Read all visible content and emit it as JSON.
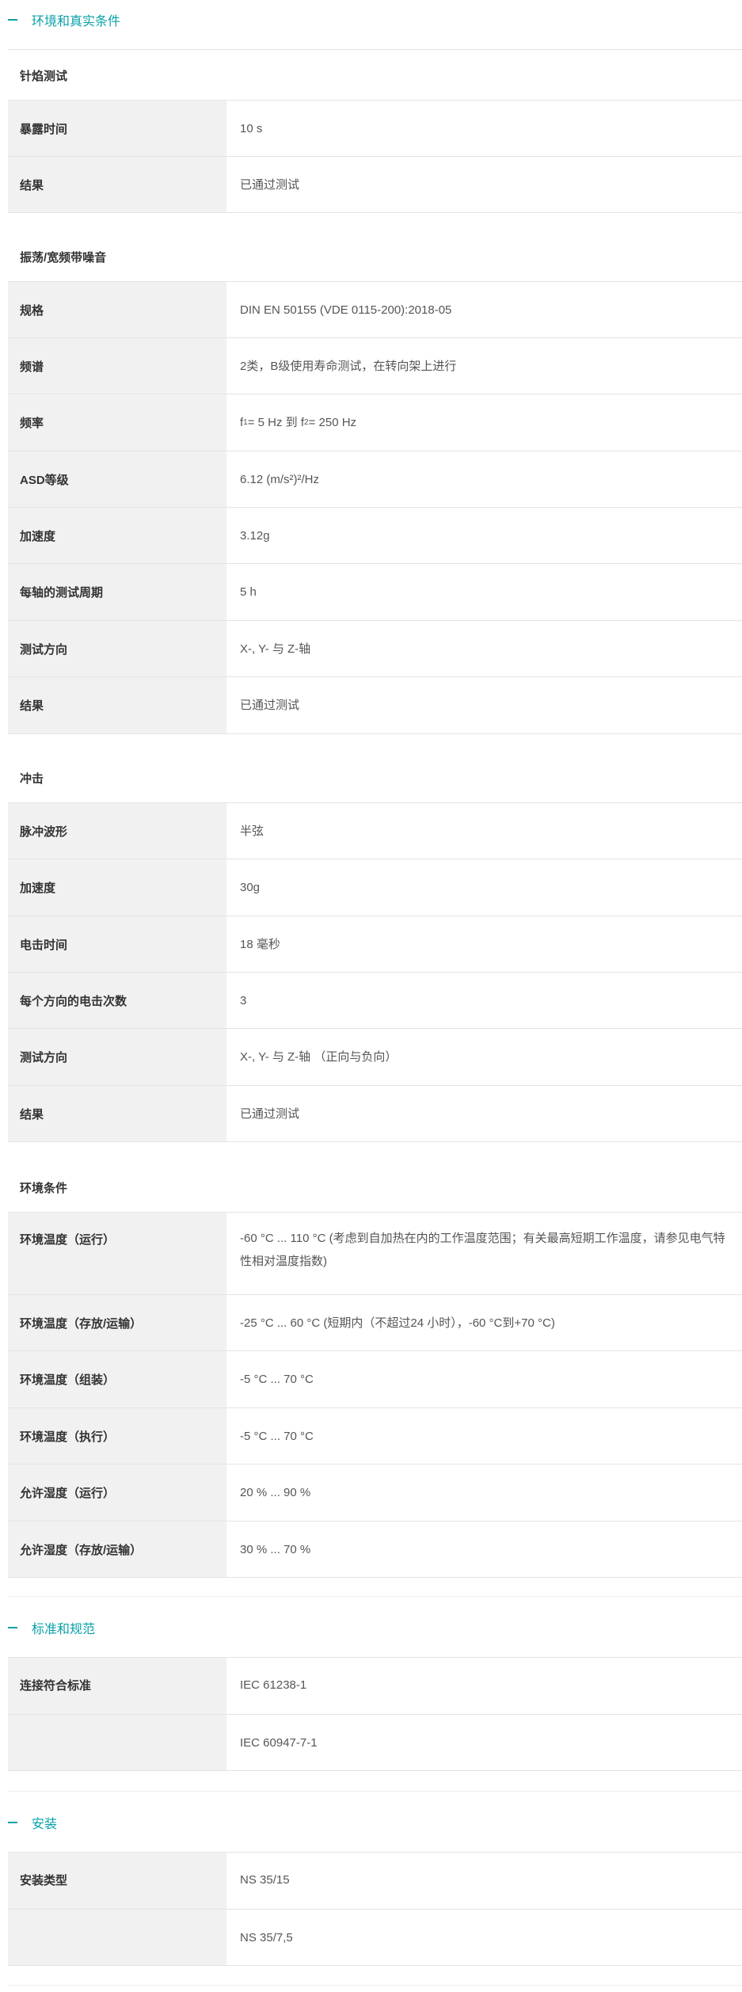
{
  "sections": {
    "env": {
      "title": "环境和真实条件"
    },
    "standards": {
      "title": "标准和规范"
    },
    "mounting": {
      "title": "安装"
    }
  },
  "needle": {
    "title": "针焰测试",
    "rows": [
      {
        "label": "暴露时间",
        "value": "10 s"
      },
      {
        "label": "结果",
        "value": "已通过测试"
      }
    ]
  },
  "vibration": {
    "title": "振荡/宽频带噪音",
    "rows": [
      {
        "label": "规格",
        "value": "DIN EN 50155 (VDE 0115-200):2018-05"
      },
      {
        "label": "频谱",
        "value": "2类，B级使用寿命测试，在转向架上进行"
      },
      {
        "label": "频率",
        "value_parts": [
          "f",
          "1",
          " = 5 Hz 到 f",
          "2",
          " = 250 Hz"
        ]
      },
      {
        "label": "ASD等级",
        "value": "6.12 (m/s²)²/Hz"
      },
      {
        "label": "加速度",
        "value": "3.12g"
      },
      {
        "label": "每轴的测试周期",
        "value": "5 h"
      },
      {
        "label": "测试方向",
        "value": "X-, Y- 与 Z-轴"
      },
      {
        "label": "结果",
        "value": "已通过测试"
      }
    ]
  },
  "shock": {
    "title": "冲击",
    "rows": [
      {
        "label": "脉冲波形",
        "value": "半弦"
      },
      {
        "label": "加速度",
        "value": "30g"
      },
      {
        "label": "电击时间",
        "value": "18 毫秒"
      },
      {
        "label": "每个方向的电击次数",
        "value": "3"
      },
      {
        "label": "测试方向",
        "value": "X-, Y- 与 Z-轴 （正向与负向）"
      },
      {
        "label": "结果",
        "value": "已通过测试"
      }
    ]
  },
  "environment": {
    "title": "环境条件",
    "rows": [
      {
        "label": "环境温度（运行）",
        "value": "-60 °C ... 110 °C (考虑到自加热在内的工作温度范围；有关最高短期工作温度，请参见电气特性相对温度指数)"
      },
      {
        "label": "环境温度（存放/运输）",
        "value": "-25 °C ... 60 °C (短期内（不超过24 小时），-60 °C到+70 °C)"
      },
      {
        "label": "环境温度（组装）",
        "value": "-5 °C ... 70 °C"
      },
      {
        "label": "环境温度（执行）",
        "value": "-5 °C ... 70 °C"
      },
      {
        "label": "允许湿度（运行）",
        "value": "20 % ... 90 %"
      },
      {
        "label": "允许湿度（存放/运输）",
        "value": "30 % ... 70 %"
      }
    ]
  },
  "standards_table": {
    "label": "连接符合标准",
    "values": [
      "IEC 61238-1",
      "IEC 60947-7-1"
    ]
  },
  "mounting_table": {
    "label": "安装类型",
    "values": [
      "NS 35/15",
      "NS 35/7,5"
    ]
  }
}
